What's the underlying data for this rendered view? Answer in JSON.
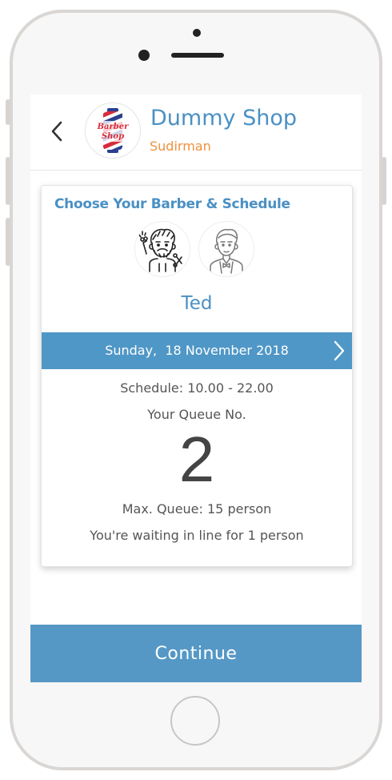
{
  "header": {
    "shop_name": "Dummy Shop",
    "branch": "Sudirman",
    "logo_text_line1": "Barber",
    "logo_text_line2": "Shop"
  },
  "card": {
    "title": "Choose Your Barber & Schedule",
    "barbers": [
      {
        "icon": "bearded-barber-icon"
      },
      {
        "icon": "young-barber-icon"
      }
    ],
    "selected_barber": "Ted",
    "date": "Sunday,  18 November 2018",
    "schedule": "Schedule: 10.00 - 22.00",
    "queue_label": "Your Queue No.",
    "queue_number": "2",
    "max_queue": "Max. Queue: 15 person",
    "waiting": "You're waiting in line for 1 person"
  },
  "footer": {
    "continue_label": "Continue"
  },
  "colors": {
    "accent_blue": "#4f97c6",
    "branch_orange": "#f0913f",
    "text_gray": "#555555"
  }
}
